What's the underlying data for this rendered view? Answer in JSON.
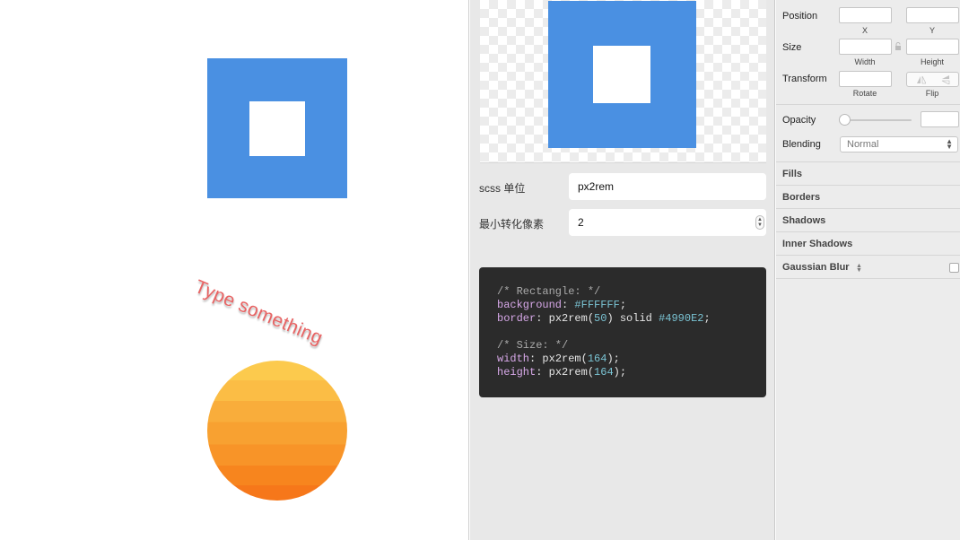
{
  "canvas": {
    "text_layer": "Type something",
    "rect_color": "#4A90E2",
    "rect_inner_color": "#FFFFFF",
    "circle_colors": [
      "#FCCA4D",
      "#F6771A"
    ]
  },
  "plugin": {
    "unit_label": "scss 单位",
    "unit_value": "px2rem",
    "min_px_label": "最小转化像素",
    "min_px_value": "2",
    "code": {
      "comment_rect": "/* Rectangle: */",
      "bg_prop": "background",
      "bg_value": "#FFFFFF",
      "border_prop": "border",
      "border_fn": "px2rem(",
      "border_num": "50",
      "border_rest": ") solid ",
      "border_color": "#4990E2",
      "comment_size": "/* Size: */",
      "width_prop": "width",
      "width_fn": "px2rem(",
      "width_num": "164",
      "height_prop": "height",
      "height_fn": "px2rem(",
      "height_num": "164",
      "fn_close": ");"
    }
  },
  "inspector": {
    "position_label": "Position",
    "x_caption": "X",
    "y_caption": "Y",
    "size_label": "Size",
    "width_caption": "Width",
    "height_caption": "Height",
    "transform_label": "Transform",
    "rotate_caption": "Rotate",
    "flip_caption": "Flip",
    "opacity_label": "Opacity",
    "opacity_level": 0,
    "blending_label": "Blending",
    "blending_value": "Normal",
    "sections": {
      "fills": "Fills",
      "borders": "Borders",
      "shadows": "Shadows",
      "inner_shadows": "Inner Shadows",
      "gaussian_blur": "Gaussian Blur"
    }
  }
}
